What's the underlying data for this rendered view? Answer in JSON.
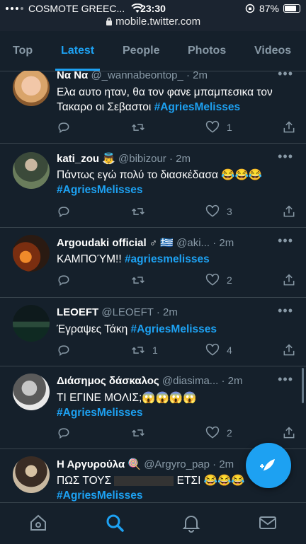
{
  "status_bar": {
    "carrier": "COSMOTE GREEC...",
    "time": "23:30",
    "battery": "87%",
    "battery_level": 0.87,
    "url": "mobile.twitter.com"
  },
  "tabs": [
    {
      "label": "Top",
      "active": false
    },
    {
      "label": "Latest",
      "active": true
    },
    {
      "label": "People",
      "active": false
    },
    {
      "label": "Photos",
      "active": false
    },
    {
      "label": "Videos",
      "active": false
    }
  ],
  "tweets": [
    {
      "name": "Να Να",
      "handle": "@_wannabeontop_",
      "time": "· 2m",
      "text": "Ελα αυτο ηταν, θα τον φανε μπαμπεσικα τον Τακαρο οι Σεβαστοι ",
      "hashtag": "#AgriesMelisses",
      "retweets": "",
      "likes": "1"
    },
    {
      "name": "kati_zou 👼",
      "handle": "@bibizour",
      "time": "· 2m",
      "text": "Πάντως εγώ πολύ το διασκέδασα 😂😂😂",
      "hashtag": "#AgriesMelisses",
      "retweets": "",
      "likes": "3"
    },
    {
      "name": "Argoudaki official ♂ 🇬🇷",
      "handle": "@aki...",
      "time": "· 2m",
      "text": "ΚΑΜΠΟΎΜ!! ",
      "hashtag": "#agriesmelisses",
      "retweets": "",
      "likes": "2"
    },
    {
      "name": "LEOEFT",
      "handle": "@LEOEFT",
      "time": "· 2m",
      "text": "Έγραψες Τάκη ",
      "hashtag": "#AgriesMelisses",
      "retweets": "1",
      "likes": "4"
    },
    {
      "name": "Διάσημος δάσκαλος",
      "handle": "@diasima...",
      "time": "· 2m",
      "text": "ΤΙ ΕΓΙΝΕ ΜΟΛΙΣ;😱😱😱😱",
      "hashtag": "#AgriesMelisses",
      "retweets": "",
      "likes": "2"
    },
    {
      "name": "Η Αργυρούλα 🍭",
      "handle": "@Argyro_pap",
      "time": "· 2m",
      "text_before": "ΠΩΣ ΤΟΥΣ ",
      "text_after": " ΕΤΣΙ 😂😂😂",
      "hashtag": "#AgriesMelisses"
    }
  ],
  "colors": {
    "background": "#15202b",
    "accent": "#1da1f2",
    "secondary_text": "#8899a6",
    "divider": "#38444d"
  },
  "bottom_nav": [
    "home-icon",
    "search-icon",
    "notifications-icon",
    "messages-icon"
  ],
  "fab_icon": "compose-tweet-icon"
}
